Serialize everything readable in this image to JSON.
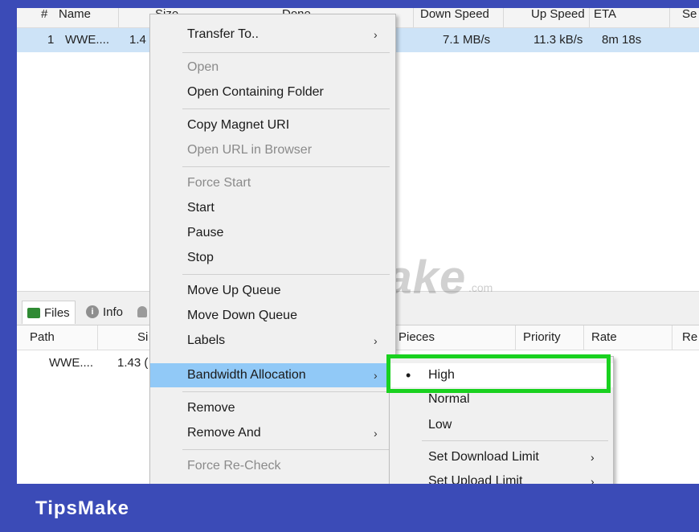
{
  "torrent_list": {
    "headers": [
      "#",
      "Name",
      "Size",
      "Done",
      "Down Speed",
      "Up Speed",
      "ETA",
      "Se"
    ],
    "row": {
      "index": "1",
      "name": "WWE....",
      "size": "1.4",
      "down_speed": "7.1 MB/s",
      "up_speed": "11.3 kB/s",
      "eta": "8m 18s"
    }
  },
  "bottom_tabs": [
    {
      "label": "Files",
      "icon": "files-icon"
    },
    {
      "label": "Info",
      "icon": "info-icon"
    },
    {
      "label": "",
      "icon": "peers-icon"
    }
  ],
  "files_table": {
    "headers": [
      "Path",
      "Si",
      "Pieces",
      "Priority",
      "Rate",
      "Re"
    ],
    "row": {
      "path": "WWE....",
      "size": "1.43 ("
    }
  },
  "context_menu": {
    "items": [
      {
        "label": "Transfer To..",
        "submenu": true,
        "disabled": false
      },
      {
        "label": "Open",
        "disabled": true
      },
      {
        "label": "Open Containing Folder",
        "disabled": false
      },
      {
        "label": "Copy Magnet URI",
        "disabled": false
      },
      {
        "label": "Open URL in Browser",
        "disabled": true
      },
      {
        "label": "Force Start",
        "disabled": true
      },
      {
        "label": "Start",
        "disabled": false
      },
      {
        "label": "Pause",
        "disabled": false
      },
      {
        "label": "Stop",
        "disabled": false
      },
      {
        "label": "Move Up Queue",
        "disabled": false
      },
      {
        "label": "Move Down Queue",
        "disabled": false
      },
      {
        "label": "Labels",
        "submenu": true,
        "disabled": false
      },
      {
        "label": "Bandwidth Allocation",
        "submenu": true,
        "highlighted": true
      },
      {
        "label": "Remove",
        "disabled": false
      },
      {
        "label": "Remove And",
        "submenu": true,
        "disabled": false
      },
      {
        "label": "Force Re-Check",
        "disabled": true
      }
    ],
    "arrow": "›"
  },
  "bandwidth_submenu": {
    "items": [
      {
        "label": "High",
        "selected": true
      },
      {
        "label": "Normal"
      },
      {
        "label": "Low"
      },
      {
        "label": "Set Download Limit",
        "submenu": true
      },
      {
        "label": "Set Upload Limit",
        "submenu": true
      }
    ],
    "bullet": "•"
  },
  "watermark": {
    "text": "TipsMake",
    "domain": ".com"
  },
  "brand": {
    "text": "TipsMake"
  },
  "colors": {
    "highlight": "#91c9f7",
    "callout": "#19d11f",
    "brand_bar": "#3b4bb7",
    "selected_row": "#cde3f7"
  }
}
